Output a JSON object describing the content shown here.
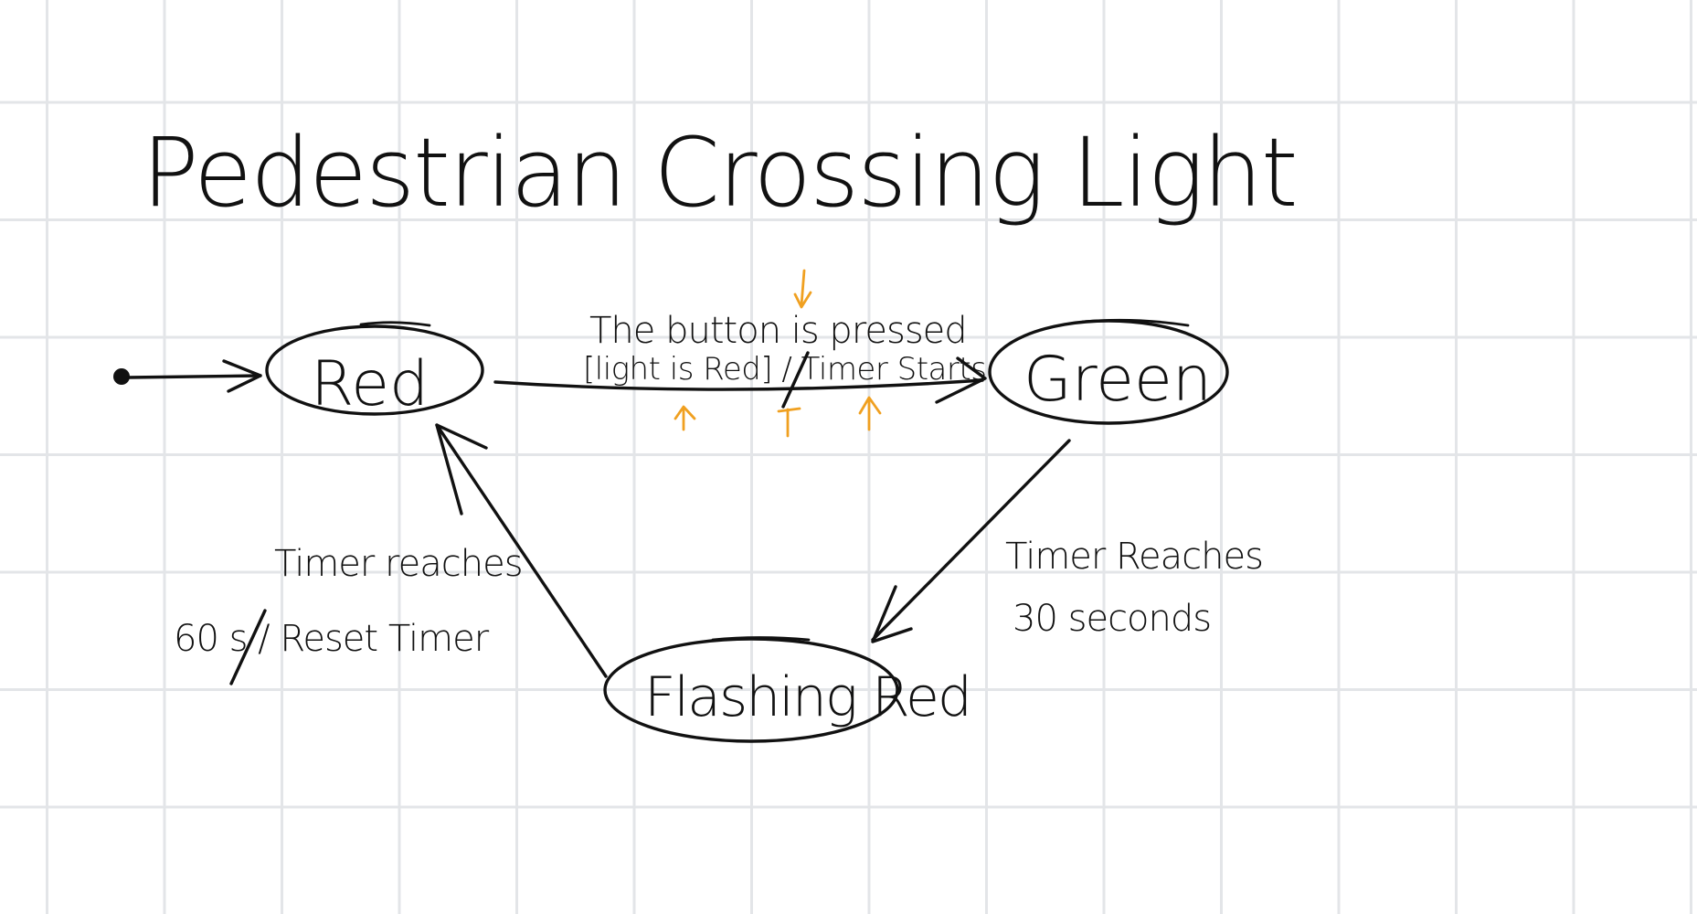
{
  "title": "Pedestrian Crossing Light",
  "states": {
    "red": "Red",
    "green": "Green",
    "flashing_red": "Flashing Red"
  },
  "transitions": {
    "red_to_green": {
      "line1": "The button is pressed",
      "line2": "[light is Red] / Timer Starts"
    },
    "green_to_flashing": {
      "line1": "Timer Reaches",
      "line2": "30 seconds"
    },
    "flashing_to_red": {
      "line1": "Timer reaches",
      "line2": "60 s / Reset Timer"
    }
  },
  "colors": {
    "ink": "#111111",
    "annotation": "#f0a020",
    "grid": "#e3e5e8",
    "background": "#ffffff"
  }
}
